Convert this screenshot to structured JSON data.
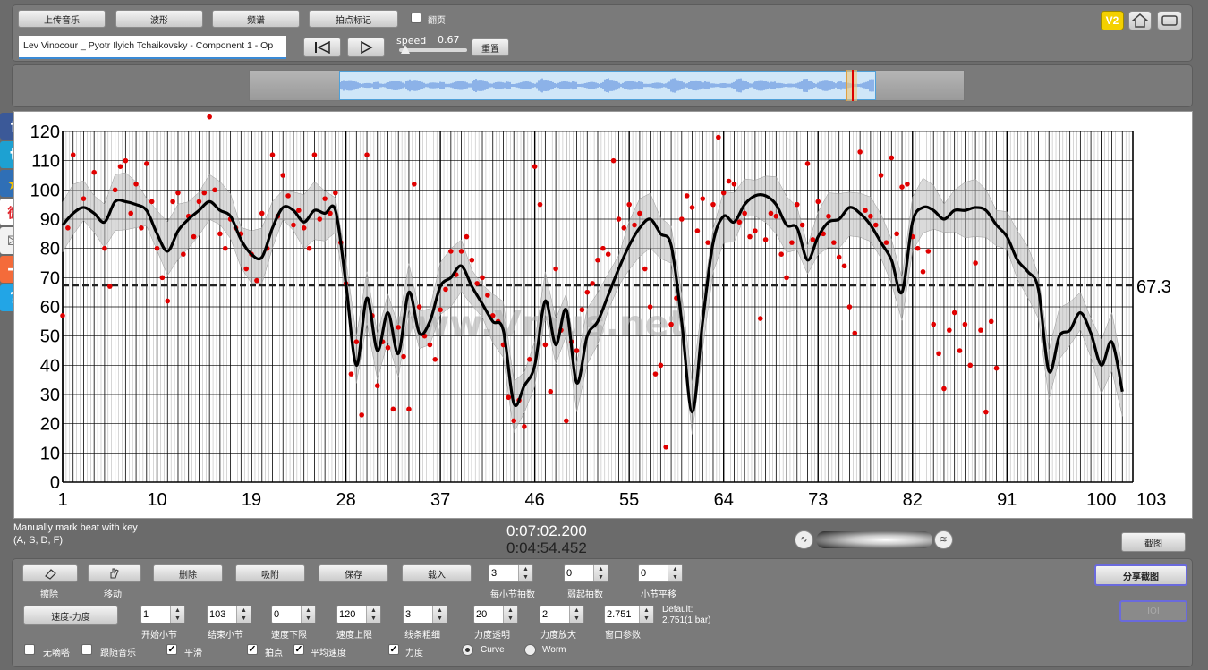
{
  "toolbar": {
    "upload_label": "上传音乐",
    "waveform_label": "波形",
    "spectrum_label": "频谱",
    "beat_mark_label": "拍点标记",
    "page_turn_label": "翻页",
    "page_turn_checked": false,
    "track_title": "Lev Vinocour _ Pyotr Ilyich Tchaikovsky - Component 1 - Op",
    "speed_label": "speed",
    "speed_value": "0.67",
    "reset_label": "重置",
    "v2_label": "V2"
  },
  "chart_data": {
    "type": "scatter",
    "x_ticks": [
      "1",
      "10",
      "19",
      "28",
      "37",
      "46",
      "55",
      "64",
      "73",
      "82",
      "91",
      "100",
      "103"
    ],
    "y_ticks": [
      "0",
      "10",
      "20",
      "30",
      "40",
      "50",
      "60",
      "70",
      "80",
      "90",
      "100",
      "110",
      "120"
    ],
    "ylim": [
      0,
      120
    ],
    "xlim": [
      1,
      103
    ],
    "average_value": 67.3,
    "average_label": "67.3",
    "watermark": "www.Vmus.net",
    "grid": true,
    "beat_colors": {
      "point": "#e00000",
      "curve": "#000000",
      "band": "#bbbbbb"
    },
    "curve": [
      [
        1,
        88
      ],
      [
        2,
        92
      ],
      [
        3,
        94
      ],
      [
        4,
        92
      ],
      [
        5,
        89
      ],
      [
        6,
        96
      ],
      [
        7,
        96
      ],
      [
        8,
        95
      ],
      [
        9,
        93
      ],
      [
        10,
        85
      ],
      [
        11,
        79
      ],
      [
        12,
        86
      ],
      [
        13,
        90
      ],
      [
        14,
        93
      ],
      [
        15,
        96
      ],
      [
        16,
        93
      ],
      [
        17,
        91
      ],
      [
        18,
        83
      ],
      [
        19,
        78
      ],
      [
        20,
        77
      ],
      [
        21,
        87
      ],
      [
        22,
        94
      ],
      [
        23,
        93
      ],
      [
        24,
        89
      ],
      [
        25,
        93
      ],
      [
        26,
        92
      ],
      [
        27,
        93
      ],
      [
        28,
        68
      ],
      [
        29,
        40
      ],
      [
        30,
        63
      ],
      [
        31,
        45
      ],
      [
        32,
        58
      ],
      [
        33,
        44
      ],
      [
        34,
        65
      ],
      [
        35,
        51
      ],
      [
        36,
        55
      ],
      [
        37,
        67
      ],
      [
        38,
        70
      ],
      [
        39,
        74
      ],
      [
        40,
        67
      ],
      [
        41,
        61
      ],
      [
        42,
        55
      ],
      [
        43,
        52
      ],
      [
        44,
        27
      ],
      [
        45,
        33
      ],
      [
        46,
        40
      ],
      [
        47,
        62
      ],
      [
        48,
        47
      ],
      [
        49,
        59
      ],
      [
        50,
        34
      ],
      [
        51,
        50
      ],
      [
        52,
        55
      ],
      [
        53,
        64
      ],
      [
        54,
        73
      ],
      [
        55,
        81
      ],
      [
        56,
        87
      ],
      [
        57,
        90
      ],
      [
        58,
        85
      ],
      [
        59,
        81
      ],
      [
        60,
        55
      ],
      [
        61,
        24
      ],
      [
        62,
        55
      ],
      [
        63,
        82
      ],
      [
        64,
        91
      ],
      [
        65,
        89
      ],
      [
        66,
        95
      ],
      [
        67,
        98
      ],
      [
        68,
        98
      ],
      [
        69,
        95
      ],
      [
        70,
        88
      ],
      [
        71,
        87
      ],
      [
        72,
        76
      ],
      [
        73,
        84
      ],
      [
        74,
        89
      ],
      [
        75,
        90
      ],
      [
        76,
        94
      ],
      [
        77,
        92
      ],
      [
        78,
        88
      ],
      [
        79,
        82
      ],
      [
        80,
        76
      ],
      [
        81,
        65
      ],
      [
        82,
        89
      ],
      [
        83,
        94
      ],
      [
        84,
        93
      ],
      [
        85,
        90
      ],
      [
        86,
        93
      ],
      [
        87,
        93
      ],
      [
        88,
        94
      ],
      [
        89,
        93
      ],
      [
        90,
        88
      ],
      [
        91,
        84
      ],
      [
        92,
        76
      ],
      [
        93,
        72
      ],
      [
        94,
        66
      ],
      [
        95,
        38
      ],
      [
        96,
        50
      ],
      [
        97,
        52
      ],
      [
        98,
        58
      ],
      [
        99,
        51
      ],
      [
        100,
        40
      ],
      [
        101,
        48
      ],
      [
        102,
        31
      ]
    ],
    "points": [
      [
        1,
        57
      ],
      [
        1.5,
        87
      ],
      [
        2,
        112
      ],
      [
        3,
        97
      ],
      [
        4,
        106
      ],
      [
        5,
        80
      ],
      [
        5.5,
        67
      ],
      [
        6,
        100
      ],
      [
        6.5,
        108
      ],
      [
        7,
        110
      ],
      [
        7.5,
        92
      ],
      [
        8,
        102
      ],
      [
        8.5,
        87
      ],
      [
        9,
        109
      ],
      [
        9.5,
        96
      ],
      [
        10,
        80
      ],
      [
        10.5,
        70
      ],
      [
        11,
        62
      ],
      [
        11.5,
        96
      ],
      [
        12,
        99
      ],
      [
        12.5,
        78
      ],
      [
        13,
        91
      ],
      [
        13.5,
        84
      ],
      [
        14,
        96
      ],
      [
        14.5,
        99
      ],
      [
        15,
        125
      ],
      [
        15.5,
        100
      ],
      [
        16,
        85
      ],
      [
        16.5,
        80
      ],
      [
        17,
        90
      ],
      [
        17.5,
        87
      ],
      [
        18,
        85
      ],
      [
        18.5,
        73
      ],
      [
        19,
        78
      ],
      [
        19.5,
        69
      ],
      [
        20,
        92
      ],
      [
        20.5,
        80
      ],
      [
        21,
        112
      ],
      [
        21.5,
        91
      ],
      [
        22,
        105
      ],
      [
        22.5,
        98
      ],
      [
        23,
        88
      ],
      [
        23.5,
        93
      ],
      [
        24,
        87
      ],
      [
        24.5,
        80
      ],
      [
        25,
        112
      ],
      [
        25.5,
        90
      ],
      [
        26,
        97
      ],
      [
        26.5,
        92
      ],
      [
        27,
        99
      ],
      [
        27.5,
        82
      ],
      [
        28,
        68
      ],
      [
        28.5,
        37
      ],
      [
        29,
        48
      ],
      [
        29.5,
        23
      ],
      [
        30,
        112
      ],
      [
        30.5,
        57
      ],
      [
        31,
        33
      ],
      [
        31.5,
        48
      ],
      [
        32,
        46
      ],
      [
        32.5,
        25
      ],
      [
        33,
        53
      ],
      [
        33.5,
        43
      ],
      [
        34,
        25
      ],
      [
        34.5,
        102
      ],
      [
        35,
        60
      ],
      [
        35.5,
        50
      ],
      [
        36,
        47
      ],
      [
        36.5,
        42
      ],
      [
        37,
        59
      ],
      [
        37.5,
        66
      ],
      [
        38,
        79
      ],
      [
        38.5,
        71
      ],
      [
        39,
        79
      ],
      [
        39.5,
        84
      ],
      [
        40,
        76
      ],
      [
        40.5,
        68
      ],
      [
        41,
        70
      ],
      [
        41.5,
        64
      ],
      [
        42,
        57
      ],
      [
        42.5,
        55
      ],
      [
        43,
        47
      ],
      [
        43.5,
        29
      ],
      [
        44,
        21
      ],
      [
        44.5,
        28
      ],
      [
        45,
        19
      ],
      [
        45.5,
        42
      ],
      [
        46,
        108
      ],
      [
        46.5,
        95
      ],
      [
        47,
        47
      ],
      [
        47.5,
        31
      ],
      [
        48,
        73
      ],
      [
        48.5,
        52
      ],
      [
        49,
        21
      ],
      [
        49.5,
        48
      ],
      [
        50,
        45
      ],
      [
        50.5,
        59
      ],
      [
        51,
        65
      ],
      [
        51.5,
        68
      ],
      [
        52,
        76
      ],
      [
        52.5,
        80
      ],
      [
        53,
        78
      ],
      [
        53.5,
        110
      ],
      [
        54,
        90
      ],
      [
        54.5,
        87
      ],
      [
        55,
        95
      ],
      [
        55.5,
        88
      ],
      [
        56,
        92
      ],
      [
        56.5,
        73
      ],
      [
        57,
        60
      ],
      [
        57.5,
        37
      ],
      [
        58,
        40
      ],
      [
        58.5,
        12
      ],
      [
        59,
        54
      ],
      [
        59.5,
        63
      ],
      [
        60,
        90
      ],
      [
        60.5,
        98
      ],
      [
        61,
        94
      ],
      [
        61.5,
        86
      ],
      [
        62,
        97
      ],
      [
        62.5,
        82
      ],
      [
        63,
        95
      ],
      [
        63.5,
        118
      ],
      [
        64,
        99
      ],
      [
        64.5,
        103
      ],
      [
        65,
        102
      ],
      [
        65.5,
        89
      ],
      [
        66,
        92
      ],
      [
        66.5,
        84
      ],
      [
        67,
        86
      ],
      [
        67.5,
        56
      ],
      [
        68,
        83
      ],
      [
        68.5,
        92
      ],
      [
        69,
        91
      ],
      [
        69.5,
        78
      ],
      [
        70,
        70
      ],
      [
        70.5,
        82
      ],
      [
        71,
        95
      ],
      [
        71.5,
        88
      ],
      [
        72,
        109
      ],
      [
        72.5,
        83
      ],
      [
        73,
        96
      ],
      [
        73.5,
        85
      ],
      [
        74,
        91
      ],
      [
        74.5,
        82
      ],
      [
        75,
        77
      ],
      [
        75.5,
        74
      ],
      [
        76,
        60
      ],
      [
        76.5,
        51
      ],
      [
        77,
        113
      ],
      [
        77.5,
        93
      ],
      [
        78,
        91
      ],
      [
        78.5,
        88
      ],
      [
        79,
        105
      ],
      [
        79.5,
        82
      ],
      [
        80,
        111
      ],
      [
        80.5,
        85
      ],
      [
        81,
        101
      ],
      [
        81.5,
        102
      ],
      [
        82,
        84
      ],
      [
        82.5,
        80
      ],
      [
        83,
        72
      ],
      [
        83.5,
        79
      ],
      [
        84,
        54
      ],
      [
        84.5,
        44
      ],
      [
        85,
        32
      ],
      [
        85.5,
        52
      ],
      [
        86,
        58
      ],
      [
        86.5,
        45
      ],
      [
        87,
        54
      ],
      [
        87.5,
        40
      ],
      [
        88,
        75
      ],
      [
        88.5,
        52
      ],
      [
        89,
        24
      ],
      [
        89.5,
        55
      ],
      [
        90,
        39
      ]
    ]
  },
  "status": {
    "hint_line1": "Manually mark beat with key",
    "hint_line2": "(A, S, D, F)",
    "current_time": "0:07:02.200",
    "total_time": "0:04:54.452",
    "screenshot_label": "截图"
  },
  "controls": {
    "erase_label": "擦除",
    "move_label": "移动",
    "delete_label": "删除",
    "snap_label": "吸附",
    "save_label": "保存",
    "load_label": "载入",
    "beats_per_bar_value": "3",
    "beats_per_bar_label": "每小节拍数",
    "pickup_value": "0",
    "pickup_label": "弱起拍数",
    "bar_shift_value": "0",
    "bar_shift_label": "小节平移",
    "tempo_dynamics_label": "速度-力度",
    "start_bar_value": "1",
    "start_bar_label": "开始小节",
    "end_bar_value": "103",
    "end_bar_label": "结束小节",
    "tempo_min_value": "0",
    "tempo_min_label": "速度下限",
    "tempo_max_value": "120",
    "tempo_max_label": "速度上限",
    "line_width_value": "3",
    "line_width_label": "线条粗细",
    "dyn_opacity_value": "20",
    "dyn_opacity_label": "力度透明",
    "dyn_scale_value": "2",
    "dyn_scale_label": "力度放大",
    "window_param_value": "2.751",
    "window_param_label": "窗口参数",
    "default_line1": "Default:",
    "default_line2": "2.751(1 bar)",
    "share_label": "分享截图",
    "io_label": "IOI",
    "no_beep_label": "无嘀嗒",
    "follow_music_label": "跟随音乐",
    "smooth_label": "平滑",
    "beat_points_label": "拍点",
    "avg_tempo_label": "平均速度",
    "dynamics_label": "力度",
    "curve_label": "Curve",
    "worm_label": "Worm"
  },
  "social": {
    "facebook": "f",
    "twitter": "t",
    "favorite": "★",
    "weibo": "微",
    "mail": "✉",
    "more": "+",
    "help": "?"
  }
}
